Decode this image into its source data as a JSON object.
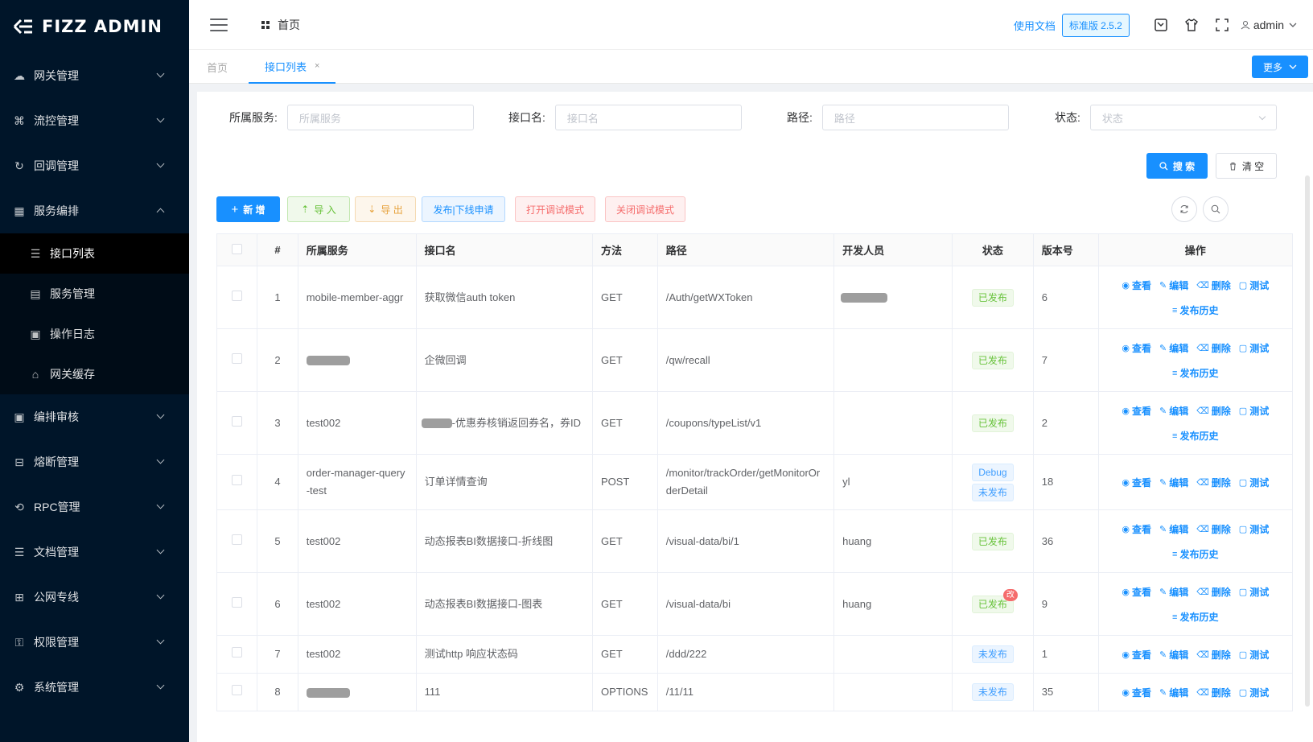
{
  "app": {
    "logo_text": "FIZZ ADMIN"
  },
  "sidebar": {
    "items": [
      {
        "label": "网关管理",
        "icon": "cloud-icon",
        "expanded": false
      },
      {
        "label": "流控管理",
        "icon": "sitemap-icon",
        "expanded": false
      },
      {
        "label": "回调管理",
        "icon": "callback-icon",
        "expanded": false
      },
      {
        "label": "服务编排",
        "icon": "apps-icon",
        "expanded": true
      },
      {
        "label": "编排审核",
        "icon": "audit-icon",
        "expanded": false
      },
      {
        "label": "熔断管理",
        "icon": "breaker-icon",
        "expanded": false
      },
      {
        "label": "RPC管理",
        "icon": "rpc-icon",
        "expanded": false
      },
      {
        "label": "文档管理",
        "icon": "doc-icon",
        "expanded": false
      },
      {
        "label": "公网专线",
        "icon": "network-icon",
        "expanded": false
      },
      {
        "label": "权限管理",
        "icon": "lock-icon",
        "expanded": false
      },
      {
        "label": "系统管理",
        "icon": "gear-icon",
        "expanded": false
      }
    ],
    "submenu": [
      {
        "label": "接口列表",
        "icon": "list-icon",
        "active": true
      },
      {
        "label": "服务管理",
        "icon": "server-icon",
        "active": false
      },
      {
        "label": "操作日志",
        "icon": "log-icon",
        "active": false
      },
      {
        "label": "网关缓存",
        "icon": "cache-icon",
        "active": false
      }
    ]
  },
  "header": {
    "breadcrumb": "首页",
    "doc_link": "使用文档",
    "version": "标准版 2.5.2",
    "user": "admin"
  },
  "tabs": {
    "items": [
      {
        "label": "首页",
        "active": false
      },
      {
        "label": "接口列表",
        "active": true,
        "close": "×"
      }
    ],
    "more": "更多"
  },
  "filters": {
    "service": {
      "label": "所属服务:",
      "placeholder": "所属服务"
    },
    "api": {
      "label": "接口名:",
      "placeholder": "接口名"
    },
    "path": {
      "label": "路径:",
      "placeholder": "路径"
    },
    "status": {
      "label": "状态:",
      "placeholder": "状态"
    }
  },
  "actions": {
    "search": "搜 索",
    "clear": "清 空",
    "add": "新 增",
    "import": "导 入",
    "export": "导 出",
    "publish": "发布|下线申请",
    "debug_on": "打开调试模式",
    "debug_off": "关闭调试模式"
  },
  "table": {
    "columns": [
      "#",
      "所属服务",
      "接口名",
      "方法",
      "路径",
      "开发人员",
      "状态",
      "版本号",
      "操作"
    ],
    "op_labels": {
      "view": "查看",
      "edit": "编辑",
      "delete": "删除",
      "test": "测试",
      "history": "发布历史"
    },
    "rows": [
      {
        "no": "1",
        "service": "mobile-member-aggr",
        "service_blurred": false,
        "name": "获取微信auth token",
        "name_prefix_blurred": false,
        "method": "GET",
        "path": "/Auth/getWXToken",
        "dev": "",
        "dev_blurred": true,
        "status": [
          "已发布"
        ],
        "badge": "",
        "version": "6",
        "history": true
      },
      {
        "no": "2",
        "service": "",
        "service_blurred": true,
        "name": "企微回调",
        "name_prefix_blurred": false,
        "method": "GET",
        "path": "/qw/recall",
        "dev": "",
        "dev_blurred": false,
        "status": [
          "已发布"
        ],
        "badge": "",
        "version": "7",
        "history": true
      },
      {
        "no": "3",
        "service": "test002",
        "service_blurred": false,
        "name": "-优惠券核销返回券名，券ID",
        "name_prefix_blurred": true,
        "method": "GET",
        "path": "/coupons/typeList/v1",
        "dev": "",
        "dev_blurred": false,
        "status": [
          "已发布"
        ],
        "badge": "",
        "version": "2",
        "history": true
      },
      {
        "no": "4",
        "service": "order-manager-query-test",
        "service_blurred": false,
        "name": "订单详情查询",
        "name_prefix_blurred": false,
        "method": "POST",
        "path": "/monitor/trackOrder/getMonitorOrderDetail",
        "dev": "yl",
        "dev_blurred": false,
        "status": [
          "Debug",
          "未发布"
        ],
        "badge": "",
        "version": "18",
        "history": false
      },
      {
        "no": "5",
        "service": "test002",
        "service_blurred": false,
        "name": "动态报表BI数据接口-折线图",
        "name_prefix_blurred": false,
        "method": "GET",
        "path": "/visual-data/bi/1",
        "dev": "huang",
        "dev_blurred": false,
        "status": [
          "已发布"
        ],
        "badge": "",
        "version": "36",
        "history": true
      },
      {
        "no": "6",
        "service": "test002",
        "service_blurred": false,
        "name": "动态报表BI数据接口-图表",
        "name_prefix_blurred": false,
        "method": "GET",
        "path": "/visual-data/bi",
        "dev": "huang",
        "dev_blurred": false,
        "status": [
          "已发布"
        ],
        "badge": "改",
        "version": "9",
        "history": true
      },
      {
        "no": "7",
        "service": "test002",
        "service_blurred": false,
        "name": "测试http 响应状态码",
        "name_prefix_blurred": false,
        "method": "GET",
        "path": "/ddd/222",
        "dev": "",
        "dev_blurred": false,
        "status": [
          "未发布"
        ],
        "badge": "",
        "version": "1",
        "history": false
      },
      {
        "no": "8",
        "service": "",
        "service_blurred": true,
        "name": "111",
        "name_prefix_blurred": false,
        "method": "OPTIONS",
        "path": "/11/11",
        "dev": "",
        "dev_blurred": false,
        "status": [
          "未发布"
        ],
        "badge": "",
        "version": "35",
        "history": false
      }
    ]
  },
  "colors": {
    "primary": "#1890ff",
    "sidebar_bg": "#001529",
    "success": "#67c23a",
    "danger": "#f56c6c",
    "warning": "#e6a23c"
  }
}
